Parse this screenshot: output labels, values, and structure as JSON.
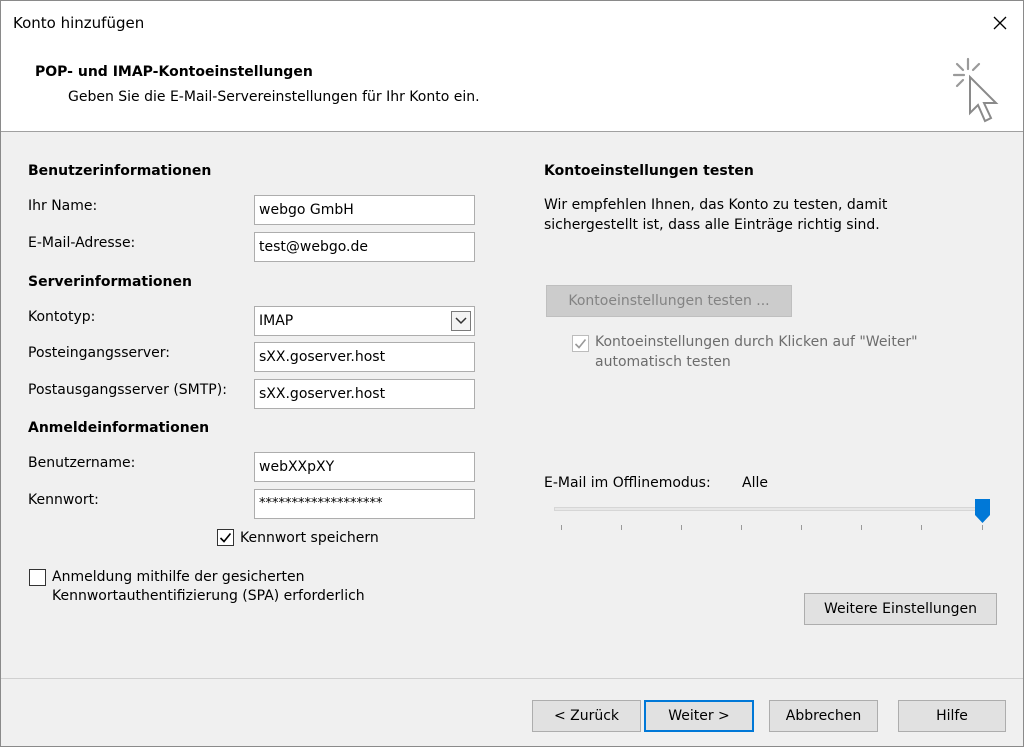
{
  "window": {
    "title": "Konto hinzufügen"
  },
  "header": {
    "title": "POP- und IMAP-Kontoeinstellungen",
    "subtitle": "Geben Sie die E-Mail-Servereinstellungen für Ihr Konto ein."
  },
  "user_info": {
    "section": "Benutzerinformationen",
    "name_label": "Ihr Name:",
    "name_value": "webgo GmbH",
    "email_label": "E-Mail-Adresse:",
    "email_value": "test@webgo.de"
  },
  "server_info": {
    "section": "Serverinformationen",
    "account_type_label": "Kontotyp:",
    "account_type_value": "IMAP",
    "incoming_label": "Posteingangsserver:",
    "incoming_value": "sXX.goserver.host",
    "outgoing_label": "Postausgangsserver (SMTP):",
    "outgoing_value": "sXX.goserver.host"
  },
  "login_info": {
    "section": "Anmeldeinformationen",
    "username_label": "Benutzername:",
    "username_value": "webXXpXY",
    "password_label": "Kennwort:",
    "password_value": "*******************",
    "remember_label": "Kennwort speichern",
    "remember_checked": true,
    "spa_label_line1": "Anmeldung mithilfe der gesicherten",
    "spa_label_line2": "Kennwortauthentifizierung (SPA) erforderlich",
    "spa_checked": false
  },
  "test_settings": {
    "section": "Kontoeinstellungen testen",
    "desc_line1": "Wir empfehlen Ihnen, das Konto zu testen, damit",
    "desc_line2": "sichergestellt ist, dass alle Einträge richtig sind.",
    "test_button": "Kontoeinstellungen testen ...",
    "auto_test_line1": "Kontoeinstellungen durch Klicken auf \"Weiter\"",
    "auto_test_line2": "automatisch testen",
    "auto_test_checked": true
  },
  "offline": {
    "label": "E-Mail im Offlinemodus:",
    "value": "Alle",
    "slider_fraction": 1.0
  },
  "more_settings_button": "Weitere Einstellungen",
  "footer": {
    "back": "< Zurück",
    "next": "Weiter >",
    "cancel": "Abbrechen",
    "help": "Hilfe"
  },
  "colors": {
    "accent": "#0078d7"
  }
}
